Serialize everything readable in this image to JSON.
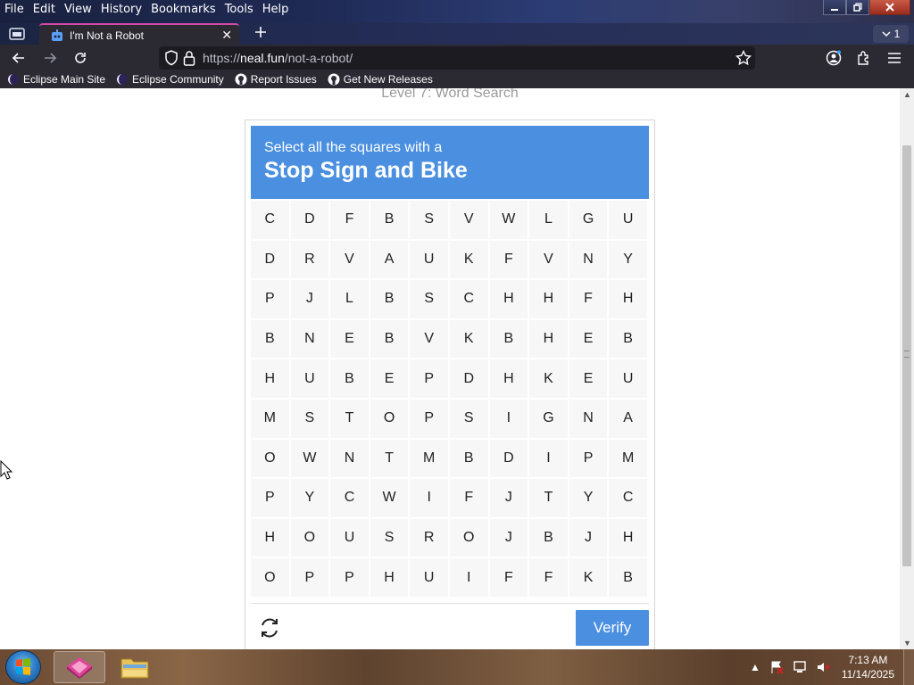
{
  "menubar": {
    "items": [
      {
        "label": "File"
      },
      {
        "label": "Edit"
      },
      {
        "label": "View"
      },
      {
        "label": "History"
      },
      {
        "label": "Bookmarks"
      },
      {
        "label": "Tools"
      },
      {
        "label": "Help"
      }
    ]
  },
  "tabs": {
    "active_title": "I'm Not a Robot",
    "count": "1"
  },
  "urlbar": {
    "scheme": "https://",
    "host": "neal.fun",
    "path": "/not-a-robot/"
  },
  "bookmarks": [
    {
      "label": "Eclipse Main Site",
      "icon": "eclipse-icon"
    },
    {
      "label": "Eclipse Community",
      "icon": "eclipse-icon"
    },
    {
      "label": "Report Issues",
      "icon": "github-icon"
    },
    {
      "label": "Get New Releases",
      "icon": "github-icon"
    }
  ],
  "page": {
    "level_title": "Level 7: Word Search",
    "captcha": {
      "prompt": "Select all the squares with a",
      "target": "Stop Sign and Bike",
      "verify_label": "Verify",
      "grid": [
        [
          "C",
          "D",
          "F",
          "B",
          "S",
          "V",
          "W",
          "L",
          "G",
          "U"
        ],
        [
          "D",
          "R",
          "V",
          "A",
          "U",
          "K",
          "F",
          "V",
          "N",
          "Y"
        ],
        [
          "P",
          "J",
          "L",
          "B",
          "S",
          "C",
          "H",
          "H",
          "F",
          "H"
        ],
        [
          "B",
          "N",
          "E",
          "B",
          "V",
          "K",
          "B",
          "H",
          "E",
          "B"
        ],
        [
          "H",
          "U",
          "B",
          "E",
          "P",
          "D",
          "H",
          "K",
          "E",
          "U"
        ],
        [
          "M",
          "S",
          "T",
          "O",
          "P",
          "S",
          "I",
          "G",
          "N",
          "A"
        ],
        [
          "O",
          "W",
          "N",
          "T",
          "M",
          "B",
          "D",
          "I",
          "P",
          "M"
        ],
        [
          "P",
          "Y",
          "C",
          "W",
          "I",
          "F",
          "J",
          "T",
          "Y",
          "C"
        ],
        [
          "H",
          "O",
          "U",
          "S",
          "R",
          "O",
          "J",
          "B",
          "J",
          "H"
        ],
        [
          "O",
          "P",
          "P",
          "H",
          "U",
          "I",
          "F",
          "F",
          "K",
          "B"
        ]
      ]
    }
  },
  "taskbar": {
    "time": "7:13 AM",
    "date": "11/14/2025"
  },
  "colors": {
    "captcha_blue": "#4a8fe0",
    "cell_bg": "#f7f7f7",
    "browser_chrome": "#2b2a33",
    "tab_accent": "#d34aa8"
  }
}
